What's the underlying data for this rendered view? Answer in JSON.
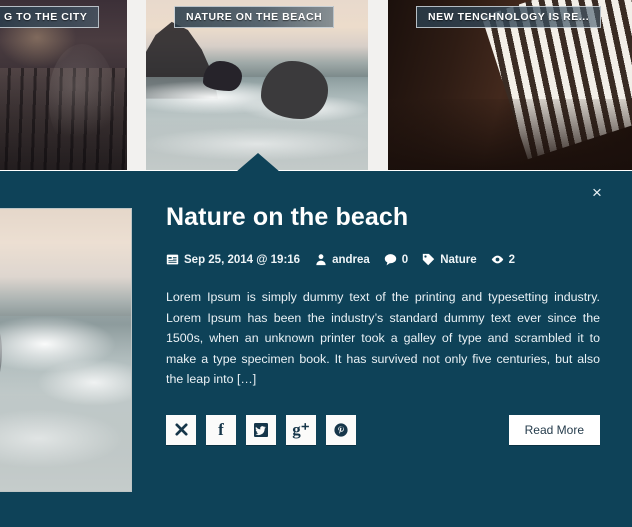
{
  "card_strip": {
    "cards": [
      {
        "title": "G TO THE CITY",
        "photo": "city-street-bicycles"
      },
      {
        "title": "NATURE ON THE BEACH",
        "photo": "rocky-beach-surf"
      },
      {
        "title": "NEW TENCHNOLOGY IS RE...",
        "photo": "dark-interior-window-blinds"
      }
    ]
  },
  "detail_panel": {
    "close_label": "×",
    "thumbnail_alt": "rocky-beach-surf",
    "title": "Nature on the beach",
    "meta": [
      {
        "icon": "calendar-icon",
        "label": "Sep 25, 2014 @ 19:16"
      },
      {
        "icon": "user-icon",
        "label": "andrea"
      },
      {
        "icon": "comment-icon",
        "label": "0"
      },
      {
        "icon": "tag-icon",
        "label": "Nature"
      },
      {
        "icon": "eye-icon",
        "label": "2"
      }
    ],
    "excerpt": "Lorem Ipsum is simply dummy text of the printing and typesetting industry. Lorem Ipsum has been the industry’s standard dummy text ever since the 1500s, when an unknown printer took a galley of type and scrambled it to make a type specimen book. It has survived not only five centuries, but also the leap into […]",
    "share_buttons": [
      {
        "icon": "close-x-icon",
        "glyph": ""
      },
      {
        "icon": "facebook-icon",
        "glyph": "f"
      },
      {
        "icon": "twitter-icon",
        "glyph": ""
      },
      {
        "icon": "google-plus-icon",
        "glyph": "g⁺"
      },
      {
        "icon": "pinterest-icon",
        "glyph": ""
      }
    ],
    "read_more_label": "Read More"
  },
  "colors": {
    "panel_background": "#0e4258",
    "card_title_bar": "#2a3c4a",
    "button_background": "#ffffff",
    "button_text": "#253c4c"
  }
}
